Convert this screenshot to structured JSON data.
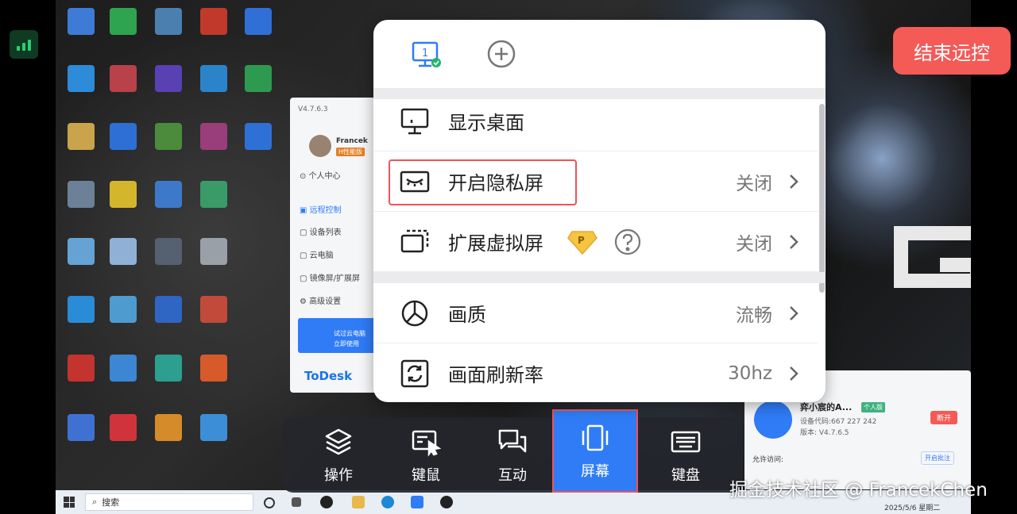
{
  "end_remote_label": "结束远控",
  "menu": {
    "items": [
      {
        "label": "显示桌面",
        "value": ""
      },
      {
        "label": "开启隐私屏",
        "value": "关闭"
      },
      {
        "label": "扩展虚拟屏",
        "value": "关闭"
      },
      {
        "label": "画质",
        "value": "流畅"
      },
      {
        "label": "画面刷新率",
        "value": "30hz"
      }
    ],
    "monitor_number": "1"
  },
  "toolbar": {
    "items": [
      {
        "label": "操作"
      },
      {
        "label": "键鼠"
      },
      {
        "label": "互动"
      },
      {
        "label": "屏幕"
      },
      {
        "label": "键盘"
      }
    ]
  },
  "todesk_window": {
    "version": "V4.7.6.3",
    "user_name": "Francek",
    "user_badge": "H性能版",
    "personal_center": "个人中心",
    "nav": [
      "远程控制",
      "设备列表",
      "云电脑",
      "镜像屏/扩展屏",
      "高级设置"
    ],
    "promo_line1": "试过云电脑",
    "promo_line2": "立即使用",
    "logo": "ToDesk"
  },
  "device_panel": {
    "name": "弈小宸的A...",
    "tag": "个人版",
    "device_code": "设备代码:667 227 242",
    "version": "版本: V4.7.6.5",
    "disconnect": "断开",
    "allow_access": "允许访问:",
    "approve": "开启批注"
  },
  "taskbar": {
    "search_placeholder": "搜索",
    "date": "2025/5/6 星期二"
  },
  "watermark": "掘金技术社区 @ FrancekChen",
  "colors": {
    "accent": "#2f7cf6",
    "danger": "#f45a56",
    "highlight_border": "#ef5458",
    "vip_gold": "#f5c542"
  }
}
